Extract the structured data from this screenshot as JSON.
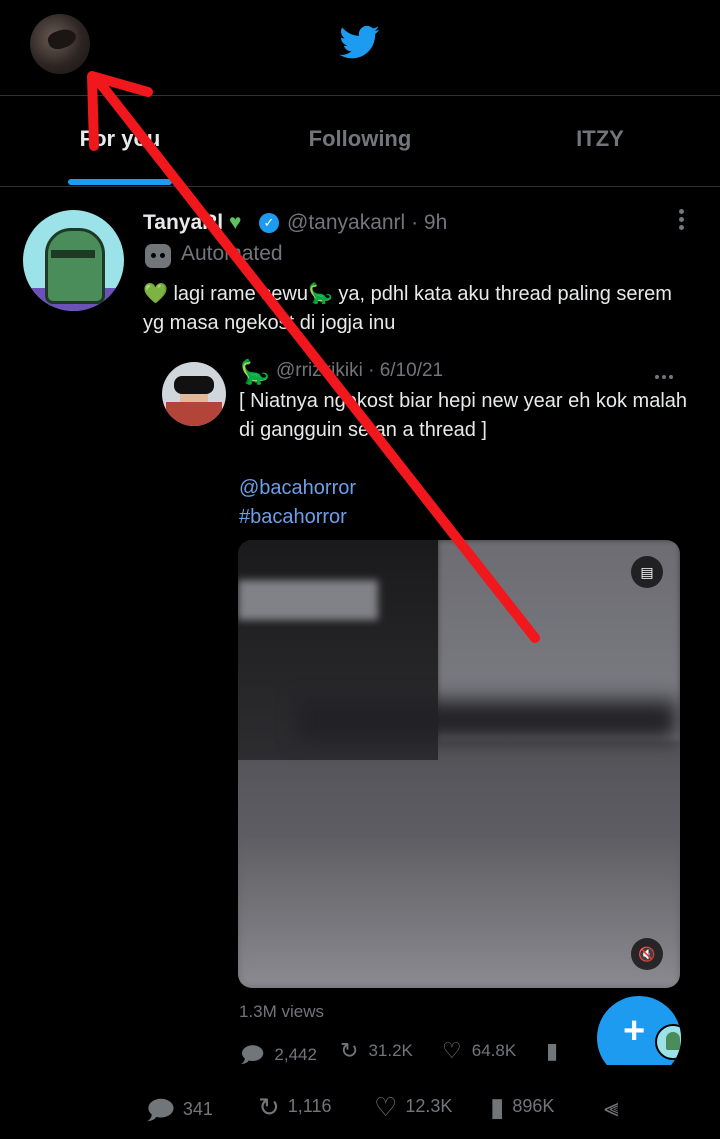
{
  "header": {
    "logo": "twitter-bird-icon"
  },
  "tabs": [
    {
      "label": "For you",
      "active": true
    },
    {
      "label": "Following",
      "active": false
    },
    {
      "label": "ITZY",
      "active": false
    }
  ],
  "tweet": {
    "name": "TanyaRl",
    "handle": "@tanyakanrl",
    "time": "· 9h",
    "automated_label": "Automated",
    "text": "💚 lagi rame sewu🦕 ya, pdhl kata aku thread paling serem yg masa ngekost di jogja inu",
    "stats": {
      "replies": "341",
      "retweets": "1,116",
      "likes": "12.3K",
      "views": "896K"
    }
  },
  "quoted": {
    "handle_time": "@rrizkikiki · 6/10/21",
    "text": "[ Niatnya ngekost biar hepi new year eh kok malah di gangguin setan a thread ]",
    "mention": "@bacahorror",
    "hashtag": "#bacahorror",
    "views": "1.3M views",
    "stats": {
      "replies": "2,442",
      "retweets": "31.2K",
      "likes": "64.8K"
    }
  },
  "colors": {
    "accent": "#1d9bf0",
    "annotation": "#f0181c"
  }
}
